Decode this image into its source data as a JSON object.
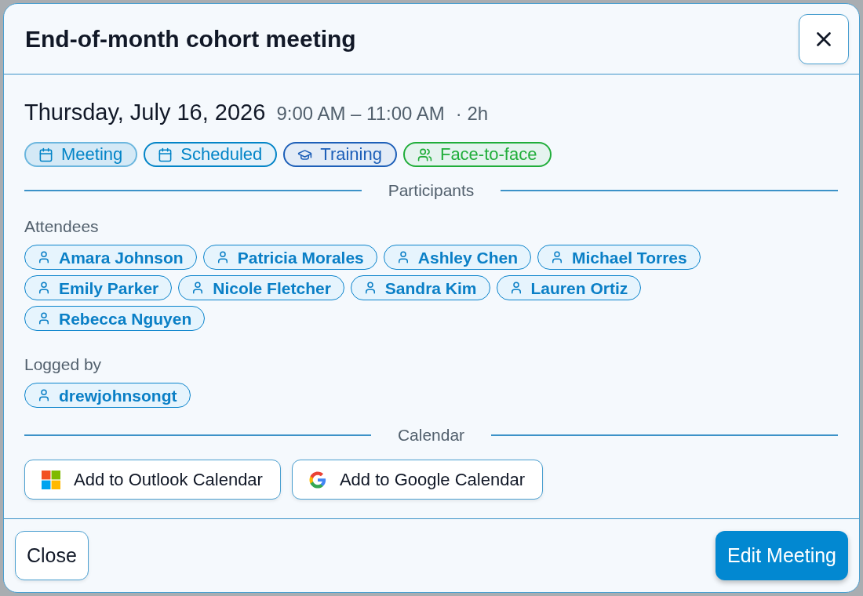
{
  "dialog": {
    "title": "End-of-month cohort meeting"
  },
  "schedule": {
    "date": "Thursday, July 16, 2026",
    "time_range": "9:00 AM – 11:00 AM",
    "duration": "· 2h"
  },
  "tags": [
    {
      "label": "Meeting",
      "kind": "type",
      "color": "#0284c7"
    },
    {
      "label": "Scheduled",
      "kind": "status",
      "color": "#0284c7"
    },
    {
      "label": "Training",
      "kind": "category",
      "color": "#1d5fb8"
    },
    {
      "label": "Face-to-face",
      "kind": "mode",
      "color": "#20ad3a"
    }
  ],
  "participants": {
    "heading": "Participants",
    "attendees_label": "Attendees",
    "attendees": [
      {
        "name": "Amara Johnson"
      },
      {
        "name": "Patricia Morales"
      },
      {
        "name": "Ashley Chen"
      },
      {
        "name": "Michael Torres"
      },
      {
        "name": "Emily Parker"
      },
      {
        "name": "Nicole Fletcher"
      },
      {
        "name": "Sandra Kim"
      },
      {
        "name": "Lauren Ortiz"
      },
      {
        "name": "Rebecca Nguyen"
      }
    ],
    "logged_by_label": "Logged by",
    "logged_by": [
      {
        "name": "drewjohnsongt"
      }
    ]
  },
  "calendar": {
    "heading": "Calendar",
    "buttons": [
      {
        "label": "Add to Outlook Calendar",
        "kind": "outlook"
      },
      {
        "label": "Add to Google Calendar",
        "kind": "google"
      }
    ]
  },
  "footer": {
    "buttons": [
      {
        "label": "Close",
        "kind": "secondary"
      },
      {
        "label": "Edit Meeting",
        "kind": "primary"
      }
    ]
  }
}
